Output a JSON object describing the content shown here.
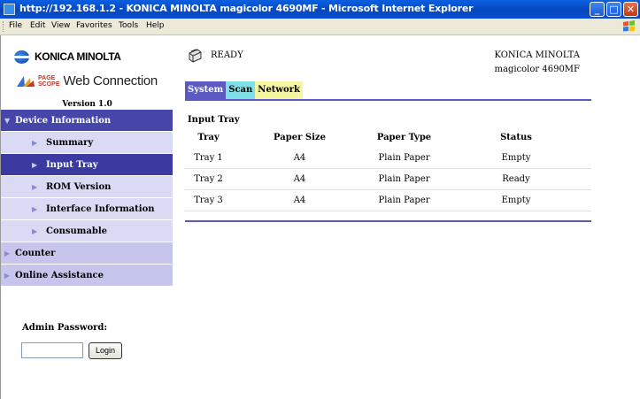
{
  "window": {
    "title": "http://192.168.1.2 - KONICA MINOLTA magicolor 4690MF - Microsoft Internet Explorer",
    "buttons": {
      "minimize": "_",
      "maximize": "□",
      "close": "✕"
    }
  },
  "menubar": {
    "items": [
      "File",
      "Edit",
      "View",
      "Favorites",
      "Tools",
      "Help"
    ]
  },
  "sidebar": {
    "brand": "KONICA MINOLTA",
    "pagescope_line1": "PAGE",
    "pagescope_line2": "SCOPE",
    "web_connection": "Web Connection",
    "version": "Version 1.0",
    "nav": [
      {
        "label": "Device Information",
        "arrow": "▼",
        "type": "head"
      },
      {
        "label": "Summary",
        "arrow": "▶",
        "type": "sub"
      },
      {
        "label": "Input Tray",
        "arrow": "▶",
        "type": "sub-active"
      },
      {
        "label": "ROM Version",
        "arrow": "▶",
        "type": "sub"
      },
      {
        "label": "Interface Information",
        "arrow": "▶",
        "type": "sub"
      },
      {
        "label": "Consumable",
        "arrow": "▶",
        "type": "sub"
      },
      {
        "label": "Counter",
        "arrow": "▶",
        "type": "top"
      },
      {
        "label": "Online Assistance",
        "arrow": "▶",
        "type": "top"
      }
    ],
    "admin_password_label": "Admin Password:",
    "password_value": "",
    "login_label": "Login"
  },
  "main": {
    "status": "READY",
    "model_line1": "KONICA MINOLTA",
    "model_line2": "magicolor 4690MF",
    "tabs": [
      "System",
      "Scan",
      "Network"
    ],
    "section_title": "Input Tray",
    "table": {
      "headers": [
        "Tray",
        "Paper Size",
        "Paper Type",
        "Status"
      ],
      "rows": [
        [
          "Tray 1",
          "A4",
          "Plain Paper",
          "Empty"
        ],
        [
          "Tray 2",
          "A4",
          "Plain Paper",
          "Ready"
        ],
        [
          "Tray 3",
          "A4",
          "Plain Paper",
          "Empty"
        ]
      ]
    }
  },
  "colors": {
    "titlebar": "#0647c0",
    "nav_head": "#4646aa",
    "nav_sub": "#dadaf4",
    "nav_top": "#c6c6ec",
    "tab_system": "#5a5ac0",
    "tab_scan": "#80e0e8",
    "tab_network": "#f6f6a0"
  }
}
